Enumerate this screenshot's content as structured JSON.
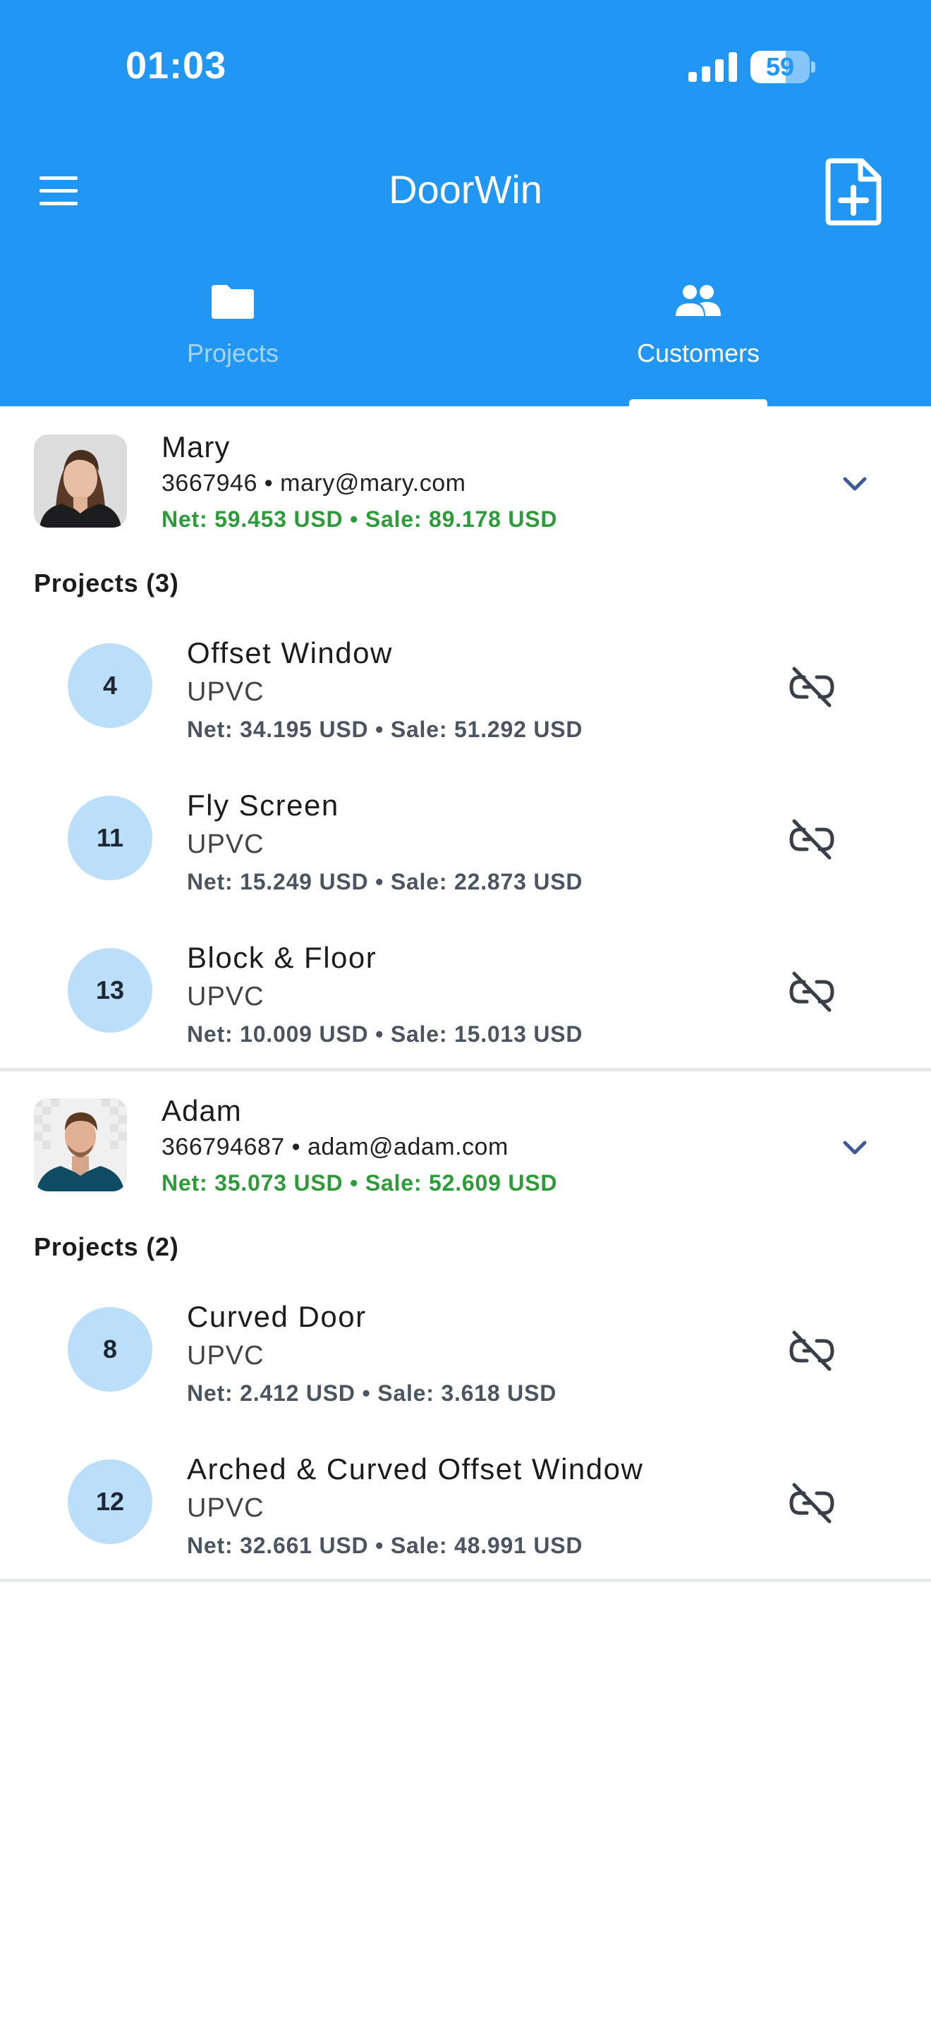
{
  "status_bar": {
    "time": "01:03",
    "battery_level": "59",
    "battery_fraction": 0.59
  },
  "app_bar": {
    "title": "DoorWin",
    "menu_icon": "hamburger-menu-icon",
    "action_icon": "add-document-icon"
  },
  "tabs": [
    {
      "label": "Projects",
      "icon": "folder-icon",
      "selected": false
    },
    {
      "label": "Customers",
      "icon": "people-icon",
      "selected": true
    }
  ],
  "customers": [
    {
      "name": "Mary",
      "contact": "3667946 • mary@mary.com",
      "totals": "Net: 59.453 USD • Sale: 89.178 USD",
      "projects_heading": "Projects (3)",
      "projects": [
        {
          "number": "4",
          "name": "Offset Window",
          "material": "UPVC",
          "totals": "Net: 34.195 USD • Sale: 51.292 USD"
        },
        {
          "number": "11",
          "name": "Fly Screen",
          "material": "UPVC",
          "totals": "Net: 15.249 USD • Sale: 22.873 USD"
        },
        {
          "number": "13",
          "name": "Block & Floor",
          "material": "UPVC",
          "totals": "Net: 10.009 USD • Sale: 15.013 USD"
        }
      ]
    },
    {
      "name": "Adam",
      "contact": "366794687 • adam@adam.com",
      "totals": "Net: 35.073 USD • Sale: 52.609 USD",
      "projects_heading": "Projects (2)",
      "projects": [
        {
          "number": "8",
          "name": "Curved Door",
          "material": "UPVC",
          "totals": "Net: 2.412 USD • Sale: 3.618 USD"
        },
        {
          "number": "12",
          "name": "Arched & Curved Offset Window",
          "material": "UPVC",
          "totals": "Net: 32.661 USD • Sale: 48.991 USD"
        }
      ]
    }
  ],
  "colors": {
    "primary": "#2196F3",
    "badge": "#BBDEFB",
    "net_sale_green": "#2E9B3A",
    "chevron": "#3F5A9A"
  }
}
